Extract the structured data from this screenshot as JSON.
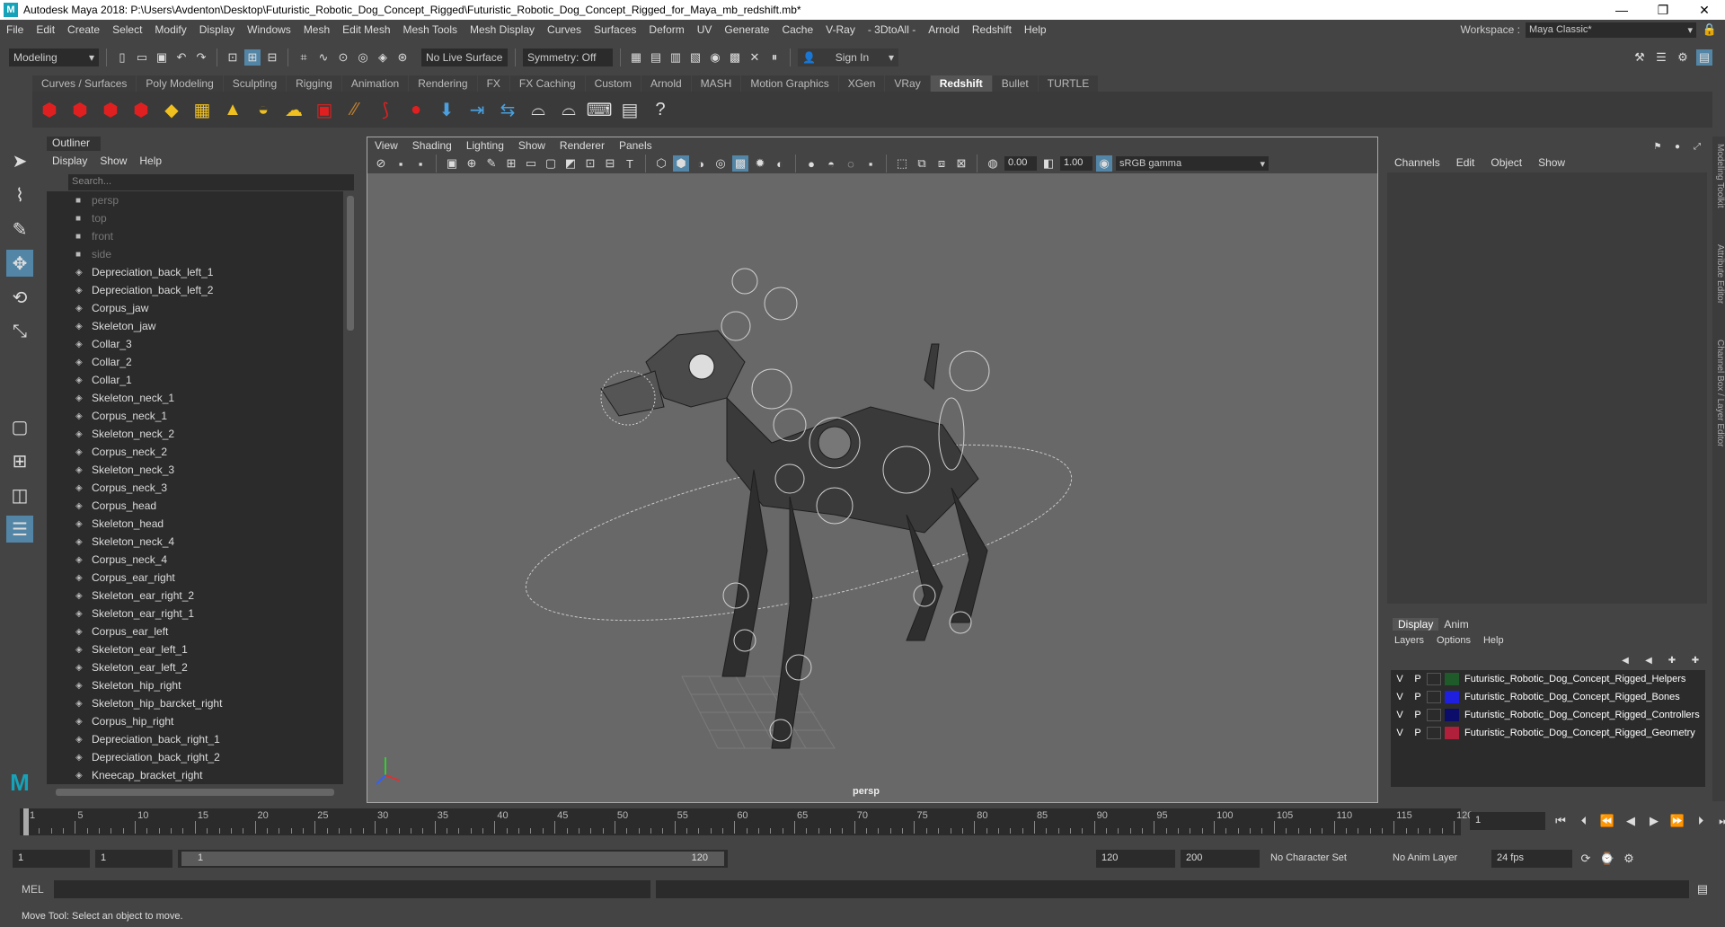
{
  "titlebar": {
    "title": "Autodesk Maya 2018: P:\\Users\\Avdenton\\Desktop\\Futuristic_Robotic_Dog_Concept_Rigged\\Futuristic_Robotic_Dog_Concept_Rigged_for_Maya_mb_redshift.mb*",
    "min": "—",
    "max": "❐",
    "close": "✕"
  },
  "menu": {
    "items": [
      "File",
      "Edit",
      "Create",
      "Select",
      "Modify",
      "Display",
      "Windows",
      "Mesh",
      "Edit Mesh",
      "Mesh Tools",
      "Mesh Display",
      "Curves",
      "Surfaces",
      "Deform",
      "UV",
      "Generate",
      "Cache",
      "V-Ray",
      "- 3DtoAll -",
      "Arnold",
      "Redshift",
      "Help"
    ],
    "workspace_label": "Workspace :",
    "workspace_value": "Maya Classic*"
  },
  "status": {
    "mode": "Modeling",
    "live_surface": "No Live Surface",
    "symmetry": "Symmetry: Off",
    "sign_in": "Sign In"
  },
  "shelf": {
    "tabs": [
      "Curves / Surfaces",
      "Poly Modeling",
      "Sculpting",
      "Rigging",
      "Animation",
      "Rendering",
      "FX",
      "FX Caching",
      "Custom",
      "Arnold",
      "MASH",
      "Motion Graphics",
      "XGen",
      "VRay",
      "Redshift",
      "Bullet",
      "TURTLE"
    ],
    "active": "Redshift",
    "labels": [
      "RV",
      "IPR",
      "PR",
      "PR",
      "PR",
      "LOG"
    ]
  },
  "outliner": {
    "title": "Outliner",
    "menu": [
      "Display",
      "Show",
      "Help"
    ],
    "search_placeholder": "Search...",
    "items": [
      {
        "name": "persp",
        "cam": true
      },
      {
        "name": "top",
        "cam": true
      },
      {
        "name": "front",
        "cam": true
      },
      {
        "name": "side",
        "cam": true
      },
      {
        "name": "Depreciation_back_left_1"
      },
      {
        "name": "Depreciation_back_left_2"
      },
      {
        "name": "Corpus_jaw"
      },
      {
        "name": "Skeleton_jaw"
      },
      {
        "name": "Collar_3"
      },
      {
        "name": "Collar_2"
      },
      {
        "name": "Collar_1"
      },
      {
        "name": "Skeleton_neck_1"
      },
      {
        "name": "Corpus_neck_1"
      },
      {
        "name": "Skeleton_neck_2"
      },
      {
        "name": "Corpus_neck_2"
      },
      {
        "name": "Skeleton_neck_3"
      },
      {
        "name": "Corpus_neck_3"
      },
      {
        "name": "Corpus_head"
      },
      {
        "name": "Skeleton_head"
      },
      {
        "name": "Skeleton_neck_4"
      },
      {
        "name": "Corpus_neck_4"
      },
      {
        "name": "Corpus_ear_right"
      },
      {
        "name": "Skeleton_ear_right_2"
      },
      {
        "name": "Skeleton_ear_right_1"
      },
      {
        "name": "Corpus_ear_left"
      },
      {
        "name": "Skeleton_ear_left_1"
      },
      {
        "name": "Skeleton_ear_left_2"
      },
      {
        "name": "Skeleton_hip_right"
      },
      {
        "name": "Skeleton_hip_barcket_right"
      },
      {
        "name": "Corpus_hip_right"
      },
      {
        "name": "Depreciation_back_right_1"
      },
      {
        "name": "Depreciation_back_right_2"
      },
      {
        "name": "Kneecap_bracket_right"
      }
    ]
  },
  "viewport": {
    "menu": [
      "View",
      "Shading",
      "Lighting",
      "Show",
      "Renderer",
      "Panels"
    ],
    "exposure": "0.00",
    "gamma": "1.00",
    "colorspace": "sRGB gamma",
    "camera": "persp"
  },
  "channel": {
    "menu": [
      "Channels",
      "Edit",
      "Object",
      "Show"
    ]
  },
  "side_tabs": [
    "Modeling Toolkit",
    "Attribute Editor",
    "Channel Box / Layer Editor"
  ],
  "layers": {
    "tabs": [
      "Display",
      "Anim"
    ],
    "menu": [
      "Layers",
      "Options",
      "Help"
    ],
    "rows": [
      {
        "v": "V",
        "p": "P",
        "color": "#1e5a2a",
        "name": "Futuristic_Robotic_Dog_Concept_Rigged_Helpers"
      },
      {
        "v": "V",
        "p": "P",
        "color": "#1f1fe0",
        "name": "Futuristic_Robotic_Dog_Concept_Rigged_Bones"
      },
      {
        "v": "V",
        "p": "P",
        "color": "#0c0c6a",
        "name": "Futuristic_Robotic_Dog_Concept_Rigged_Controllers"
      },
      {
        "v": "V",
        "p": "P",
        "color": "#b0203a",
        "name": "Futuristic_Robotic_Dog_Concept_Rigged_Geometry"
      }
    ]
  },
  "timeline": {
    "ticks": [
      "1",
      "5",
      "10",
      "15",
      "20",
      "25",
      "30",
      "35",
      "40",
      "45",
      "50",
      "55",
      "60",
      "65",
      "70",
      "75",
      "80",
      "85",
      "90",
      "95",
      "100",
      "105",
      "110",
      "115",
      "120"
    ],
    "current": "1"
  },
  "range": {
    "start": "1",
    "start2": "1",
    "inner_start": "1",
    "inner_end": "120",
    "end": "120",
    "end2": "200",
    "character": "No Character Set",
    "anim_layer": "No Anim Layer",
    "fps": "24 fps"
  },
  "cmd": {
    "label": "MEL"
  },
  "help": {
    "text": "Move Tool: Select an object to move."
  }
}
